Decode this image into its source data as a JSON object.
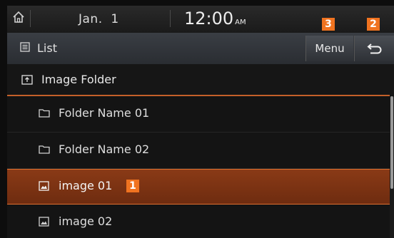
{
  "status": {
    "date": "Jan.  1",
    "time": "12:00",
    "ampm": "AM"
  },
  "header": {
    "title": "List",
    "menu_label": "Menu"
  },
  "path": {
    "label": "Image Folder"
  },
  "items": [
    {
      "label": "Folder Name 01",
      "type": "folder-icon"
    },
    {
      "label": "Folder Name 02",
      "type": "folder-icon"
    },
    {
      "label": "image 01",
      "type": "image-icon",
      "selected": true
    },
    {
      "label": "image 02",
      "type": "image-icon"
    }
  ],
  "callouts": {
    "item": "1",
    "back": "2",
    "menu": "3"
  },
  "colors": {
    "accent": "#f07320",
    "selected_bg": "#8a3a16"
  }
}
